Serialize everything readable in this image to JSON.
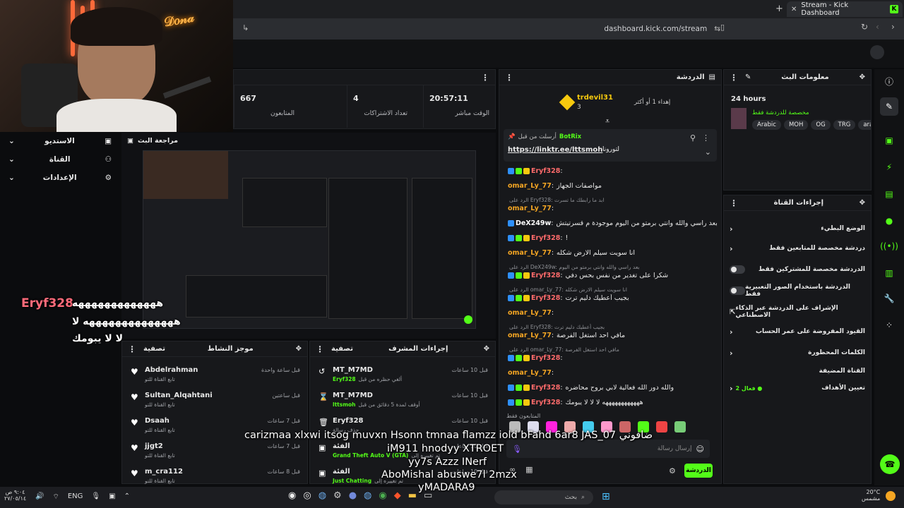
{
  "browser": {
    "tab_title": "Stream - Kick Dashboard",
    "new_tab": "+",
    "url": "dashboard.kick.com/stream"
  },
  "left_nav": [
    {
      "label": "الاستديو"
    },
    {
      "label": "القناة"
    },
    {
      "label": "الإعدادات"
    }
  ],
  "stats": [
    {
      "value": "667",
      "label": "المتابعون"
    },
    {
      "value": "4",
      "label": "تعداد الاشتراكات"
    },
    {
      "value": "20:57:11",
      "label": "الوقت مباشر"
    }
  ],
  "preview": {
    "title": "مراجعة البث"
  },
  "overlay": {
    "name": "Eryf328",
    "line1": "هههههههههههههه",
    "line2": "ههههههههههههههه لا",
    "line3": "لا لا يبومك"
  },
  "activity": {
    "title": "موجز النشاط",
    "filter": "تصفية",
    "items": [
      {
        "name": "Abdelrahman",
        "sub": "تابع القناة للتو",
        "time": "قبل ساعة واحدة"
      },
      {
        "name": "Sultan_Alqahtani",
        "sub": "تابع القناة للتو",
        "time": "قبل ساعتين"
      },
      {
        "name": "Dsaah",
        "sub": "تابع القناة للتو",
        "time": "قبل 7 ساعات"
      },
      {
        "name": "jjgt2",
        "sub": "تابع القناة للتو",
        "time": "قبل 7 ساعات"
      },
      {
        "name": "m_cra112",
        "sub": "تابع القناة للتو",
        "time": "قبل 8 ساعات"
      }
    ]
  },
  "modlog": {
    "title": "إجراءات المشرف",
    "filter": "تصفية",
    "items": [
      {
        "name": "MT_M7MD",
        "sub": "ألغي حظره من قبل",
        "target": "Eryf328",
        "time": "قبل 10 ساعات"
      },
      {
        "name": "MT_M7MD",
        "sub": "أوقف لمدة 5 دقائق من قبل",
        "target": "lttsmoh",
        "time": "قبل 10 ساعات"
      },
      {
        "name": "Eryf328",
        "sub": "حذف رسالة",
        "target": "",
        "time": "قبل 10 ساعات"
      },
      {
        "name": "الفئة",
        "sub": "تم تغييره إلى",
        "target": "Grand Theft Auto V (GTA)",
        "time": "قبل 10 ساعات"
      },
      {
        "name": "الفئة",
        "sub": "تم تغييره إلى",
        "target": "Just Chatting",
        "time": "قبل 10 ساعات"
      }
    ]
  },
  "chat": {
    "title": "الدردشة",
    "gift": {
      "user": "trdevil31",
      "count": "3",
      "note": "إهداء 1 أو أكثر"
    },
    "pinned": {
      "by": "أرسلت من قبل",
      "bot": "BotRix",
      "link": "https://linktr.ee/lttsmoh",
      "tag": "لتورونا"
    },
    "messages": [
      {
        "user": "Eryf328",
        "text": ""
      },
      {
        "user": "omar_Ly_77",
        "text": "مواصفات الجهاز"
      },
      {
        "user": "omar_Ly_77",
        "reply": "الرد على Eryf328: ابد ما رابطك ما تسرت",
        "text": ""
      },
      {
        "user": "DeX249w",
        "text": "بعد راسي والله وانتي برمتو من اليوم موجودة م قسرتيتش"
      },
      {
        "user": "Eryf328",
        "text": "!"
      },
      {
        "user": "omar_Ly_77",
        "text": "انا سويت سيلم الارض شكله"
      },
      {
        "user": "Eryf328",
        "reply": "الرد على DeX249w: بعد راسي والله وانتي برمتو من اليوم",
        "text": "شكرا على تغدير من نفس بحس دفي"
      },
      {
        "user": "Eryf328",
        "reply": "الرد على omar_Ly_77: انا سويت سيلم الارض شكله",
        "text": "بجيب أعطيك دليم ترت"
      },
      {
        "user": "omar_Ly_77",
        "text": ""
      },
      {
        "user": "omar_Ly_77",
        "reply": "الرد على Eryf328: بجيب أعطيك دليم ترت",
        "text": "مافي احد استغل الفرصة"
      },
      {
        "user": "Eryf328",
        "reply": "الرد على omar_Ly_77: مافي احد استغل الفرصة",
        "text": ""
      },
      {
        "user": "omar_Ly_77",
        "text": ""
      },
      {
        "user": "Eryf328",
        "text": "والله دور الله فعالية لابي بروح محاضره"
      },
      {
        "user": "Eryf328",
        "text": "ههههههههههههه لا لا لا يبومك"
      }
    ],
    "followers_only": "المتابعون فقط",
    "input_placeholder": "إرسال رسالة",
    "send_label": "الدردشة"
  },
  "stream_info": {
    "title": "معلومات البث",
    "duration": "24 hours",
    "category_note": "مخصصة للدردشة فقط",
    "tags": [
      "Arabic",
      "MOH",
      "OG",
      "TRG",
      "arabi"
    ]
  },
  "channel_actions": {
    "title": "إجراءات القناة",
    "items": [
      {
        "label": "الوضع البطيء",
        "control": "chevron"
      },
      {
        "label": "دردشة مخصصة للمتابعين فقط",
        "control": "chevron"
      },
      {
        "label": "الدردشة مخصصة للمشتركين فقط",
        "control": "toggle"
      },
      {
        "label": "الدردشة باستخدام الصور التعبيرية فقط",
        "control": "toggle"
      },
      {
        "label": "الإشراف على الدردشة عبر الذكاء الاصطناعي",
        "control": "external"
      },
      {
        "label": "القيود المفروضة على عمر الحساب",
        "control": "chevron"
      },
      {
        "label": "الكلمات المحظورة",
        "control": "chevron"
      },
      {
        "label": "القناة المضيفة",
        "control": "none"
      },
      {
        "label": "تعيين الأهداف",
        "control": "chevron",
        "extra": "فعال 2 ●"
      }
    ]
  },
  "taskbar": {
    "lang": "ENG",
    "time": "٩:٠٤ ص",
    "date": "٢٧/٠٥/١٤",
    "weather": "20°C",
    "weather_desc": "مشمس",
    "search": "بحث"
  },
  "subtitles": [
    "carizmaa xlxwi itsog muvxn Hsonn tmnaa flamzz iold bFahd 6ar8 JAS_07 ضافوني",
    "iM911 hnodyy XTROET",
    "yy7s Azzz INerf",
    "AboMishal abuswe7l 2mzx",
    "yMADARA9"
  ],
  "colors": {
    "kick_green": "#53fc18",
    "panel": "#17181b",
    "bg": "#0b0c0e"
  }
}
